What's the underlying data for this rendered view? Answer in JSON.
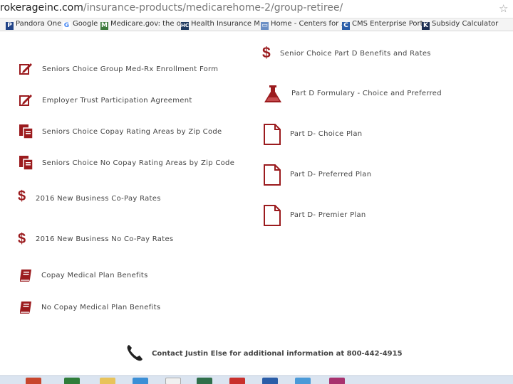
{
  "browser": {
    "url_host": "rokerageinc.com",
    "url_path": "/insurance-products/medicarehome-2/group-retiree/",
    "bookmarks": [
      {
        "label": "Pandora One",
        "icon": "pandora-icon",
        "color": "#224488"
      },
      {
        "label": "Google",
        "icon": "google-icon",
        "color": "#4285f4"
      },
      {
        "label": "Medicare.gov: the o...",
        "icon": "medicare-icon",
        "color": "#3d7a3d"
      },
      {
        "label": "Health Insurance M...",
        "icon": "hc-icon",
        "color": "#1f3a5f"
      },
      {
        "label": "Home - Centers for ...",
        "icon": "cms-home-icon",
        "color": "#6b8fc5"
      },
      {
        "label": "CMS Enterprise Port...",
        "icon": "cms-portal-icon",
        "color": "#2a5da8"
      },
      {
        "label": "Subsidy Calculator",
        "icon": "kff-icon",
        "color": "#1c2e52"
      }
    ]
  },
  "theme": {
    "accent": "#9b1b1e",
    "link_text": "#444444"
  },
  "left_links": [
    {
      "label": "Seniors Choice Group Med-Rx Enrollment Form",
      "icon": "edit-form-icon"
    },
    {
      "label": "Employer Trust Participation Agreement",
      "icon": "edit-form-icon"
    },
    {
      "label": "Seniors Choice Copay Rating Areas by Zip Code",
      "icon": "documents-icon"
    },
    {
      "label": "Seniors Choice No Copay Rating Areas by Zip Code",
      "icon": "documents-icon"
    },
    {
      "label": "2016 New Business Co-Pay Rates",
      "icon": "dollar-icon"
    },
    {
      "label": "2016 New Business No Co-Pay Rates",
      "icon": "dollar-icon"
    },
    {
      "label": "Copay Medical Plan Benefits",
      "icon": "book-icon"
    },
    {
      "label": "No Copay Medical Plan Benefits",
      "icon": "book-icon"
    }
  ],
  "right_links": [
    {
      "label": "Senior Choice Part D Benefits and Rates",
      "icon": "dollar-icon"
    },
    {
      "label": "Part D Formulary - Choice and Preferred",
      "icon": "flask-icon"
    },
    {
      "label": "Part D- Choice Plan",
      "icon": "document-icon"
    },
    {
      "label": "Part D- Preferred Plan",
      "icon": "document-icon"
    },
    {
      "label": "Part D- Premier Plan",
      "icon": "document-icon"
    }
  ],
  "contact": {
    "text": "Contact Justin Else for additional information at 800-442-4915",
    "icon": "phone-icon"
  },
  "taskbar": {
    "apps": [
      "powerpoint-icon",
      "excel-icon",
      "file-explorer-icon",
      "chrome-icon",
      "word-icon",
      "outlook-icon",
      "paint-icon",
      "app-icon"
    ]
  }
}
